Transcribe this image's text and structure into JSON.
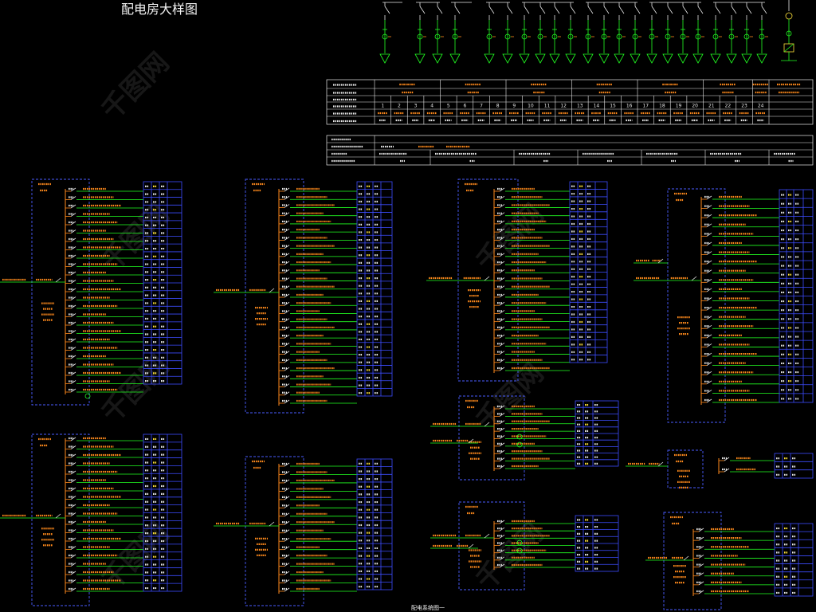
{
  "title": "配电房大样图",
  "caption": "配电系统图一",
  "table": {
    "column_numbers": [
      "1",
      "2",
      "3",
      "4",
      "5",
      "6",
      "7",
      "8",
      "9",
      "10",
      "11",
      "12",
      "13",
      "14",
      "15",
      "16",
      "17",
      "18",
      "19",
      "20",
      "21",
      "22",
      "23",
      "24"
    ]
  },
  "watermark": "千图网",
  "colors": {
    "background": "#000000",
    "circuit_line": "#22ff22",
    "label_text": "#ff8a1c",
    "panel_frame": "#4a5cff",
    "table_grid": "#3d4dff",
    "table_lines": "#e8e8e8",
    "highlight": "#ffe23a"
  }
}
